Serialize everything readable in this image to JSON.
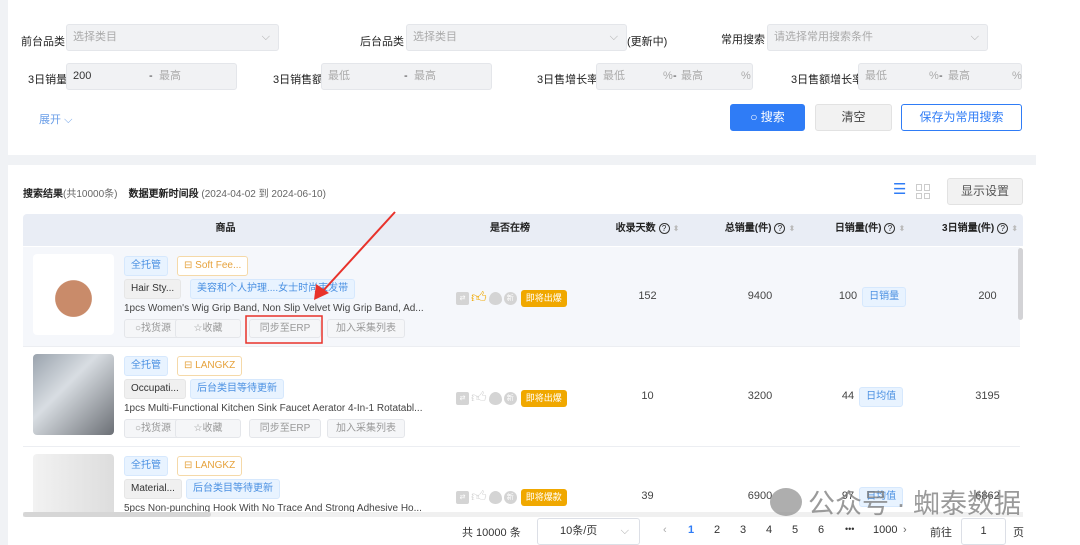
{
  "filters": {
    "front_category": {
      "label": "前台品类",
      "placeholder": "选择类目"
    },
    "back_category": {
      "label": "后台品类",
      "placeholder": "选择类目",
      "status": "(更新中)"
    },
    "saved_search": {
      "label": "常用搜索",
      "placeholder": "请选择常用搜索条件"
    },
    "sales_3d": {
      "label": "3日销量",
      "min_value": "200",
      "max_placeholder": "最高"
    },
    "revenue_3d": {
      "label": "3日销售额",
      "min_placeholder": "最低",
      "max_placeholder": "最高"
    },
    "sales_growth_3d": {
      "label": "3日售增长率",
      "min_placeholder": "最低",
      "max_placeholder": "最高",
      "unit": "%"
    },
    "revenue_growth_3d": {
      "label": "3日售额增长率",
      "min_placeholder": "最低",
      "max_placeholder": "最高",
      "unit": "%"
    },
    "expand": "展开",
    "search_button": "搜索",
    "clear_button": "清空",
    "save_button": "保存为常用搜索"
  },
  "results": {
    "label": "搜索结果",
    "count": "(共10000条)",
    "period_label": "数据更新时间段",
    "period": "(2024-04-02 到 2024-06-10)",
    "display_settings": "显示设置"
  },
  "table": {
    "columns": [
      "商品",
      "是否在榜",
      "收录天数",
      "总销量(件)",
      "日销量(件)",
      "3日销量(件)"
    ],
    "rows": [
      {
        "tag1": "全托管",
        "shop": "Soft Fee...",
        "cat1": "Hair Sty...",
        "cat2": "美容和个人护理....女士时尚束发带",
        "title": "1pcs Women's Wig Grip Band, Non Slip Velvet Wig Grip Band, Ad...",
        "badge": "即将出爆",
        "days": "152",
        "total": "9400",
        "daily": "100",
        "daily_tag": "日销量",
        "sales3": "200"
      },
      {
        "tag1": "全托管",
        "shop": "LANGKZ",
        "cat1": "Occupati...",
        "cat2": "后台类目等待更新",
        "title": "1pcs Multi-Functional Kitchen Sink Faucet Aerator 4-In-1 Rotatabl...",
        "badge": "即将出爆",
        "days": "10",
        "total": "3200",
        "daily": "44",
        "daily_tag": "日均值",
        "sales3": "3195"
      },
      {
        "tag1": "全托管",
        "shop": "LANGKZ",
        "cat1": "Material...",
        "cat2": "后台类目等待更新",
        "title": "5pcs Non-punching Hook With No Trace And Strong Adhesive Ho...",
        "badge": "即将爆款",
        "days": "39",
        "total": "6900",
        "daily": "97",
        "daily_tag": "日均值",
        "sales3": "6862"
      }
    ],
    "actions": [
      "找货源",
      "收藏",
      "同步至ERP",
      "加入采集列表"
    ]
  },
  "pagination": {
    "total": "共 10000 条",
    "page_size": "10条/页",
    "pages": [
      "1",
      "2",
      "3",
      "4",
      "5",
      "6",
      "1000"
    ],
    "ellipsis": "•••",
    "goto_label": "前往",
    "goto_value": "1",
    "goto_unit": "页"
  },
  "watermark": "公众号 · 蜘泰数据",
  "colors": {
    "primary": "#2f7cf6",
    "badge": "#f0a800",
    "annotation": "#e8322b"
  }
}
